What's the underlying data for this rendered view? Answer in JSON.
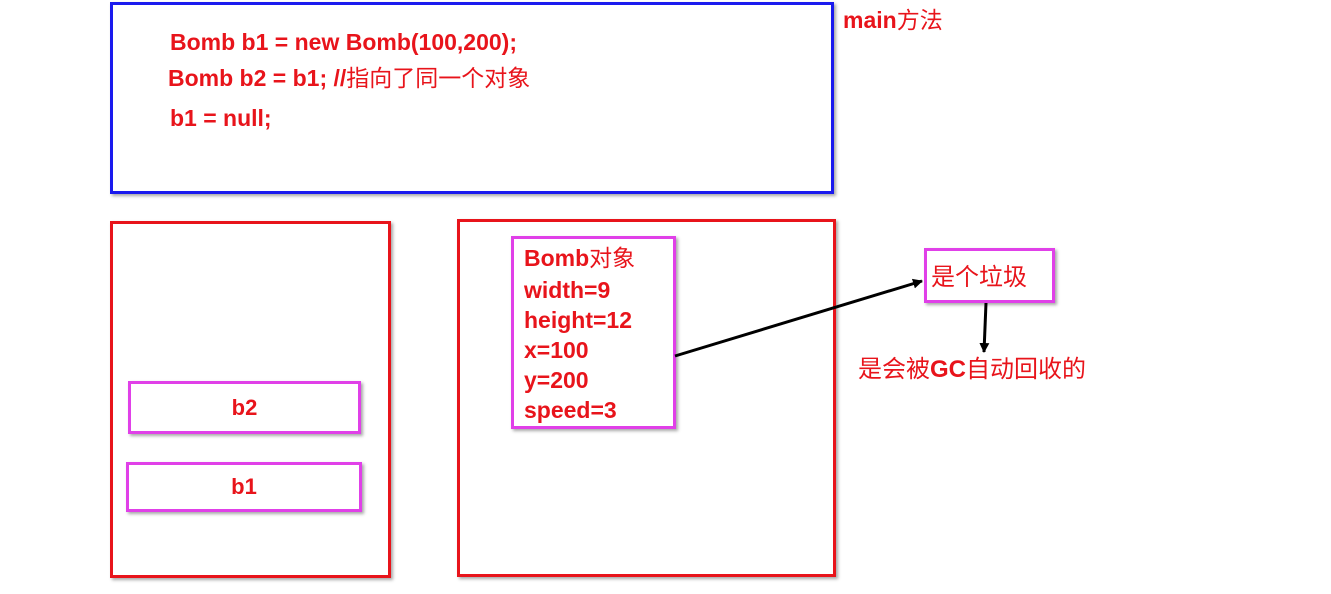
{
  "main": {
    "label_prefix": "main",
    "label_suffix": "方法",
    "code": [
      {
        "code": "Bomb b1 = new Bomb(100,200);",
        "comment": ""
      },
      {
        "code": "Bomb b2 = b1;  //",
        "comment": "指向了同一个对象"
      },
      {
        "code": "b1 = null;",
        "comment": ""
      }
    ]
  },
  "stack": {
    "vars": [
      "b2",
      "b1"
    ]
  },
  "heap": {
    "object": {
      "title_prefix": "Bomb",
      "title_suffix": "对象",
      "fields": [
        "width=9",
        "height=12",
        "x=100",
        "y=200",
        "speed=3"
      ]
    }
  },
  "garbage": {
    "label": "是个垃圾",
    "note_before": "是会被",
    "note_bold": "GC",
    "note_after": "自动回收的"
  },
  "colors": {
    "text": "#e8141b",
    "main_border": "#1a1aee",
    "region_border": "#e8141b",
    "item_border": "#e040e8",
    "arrow": "#000000"
  }
}
